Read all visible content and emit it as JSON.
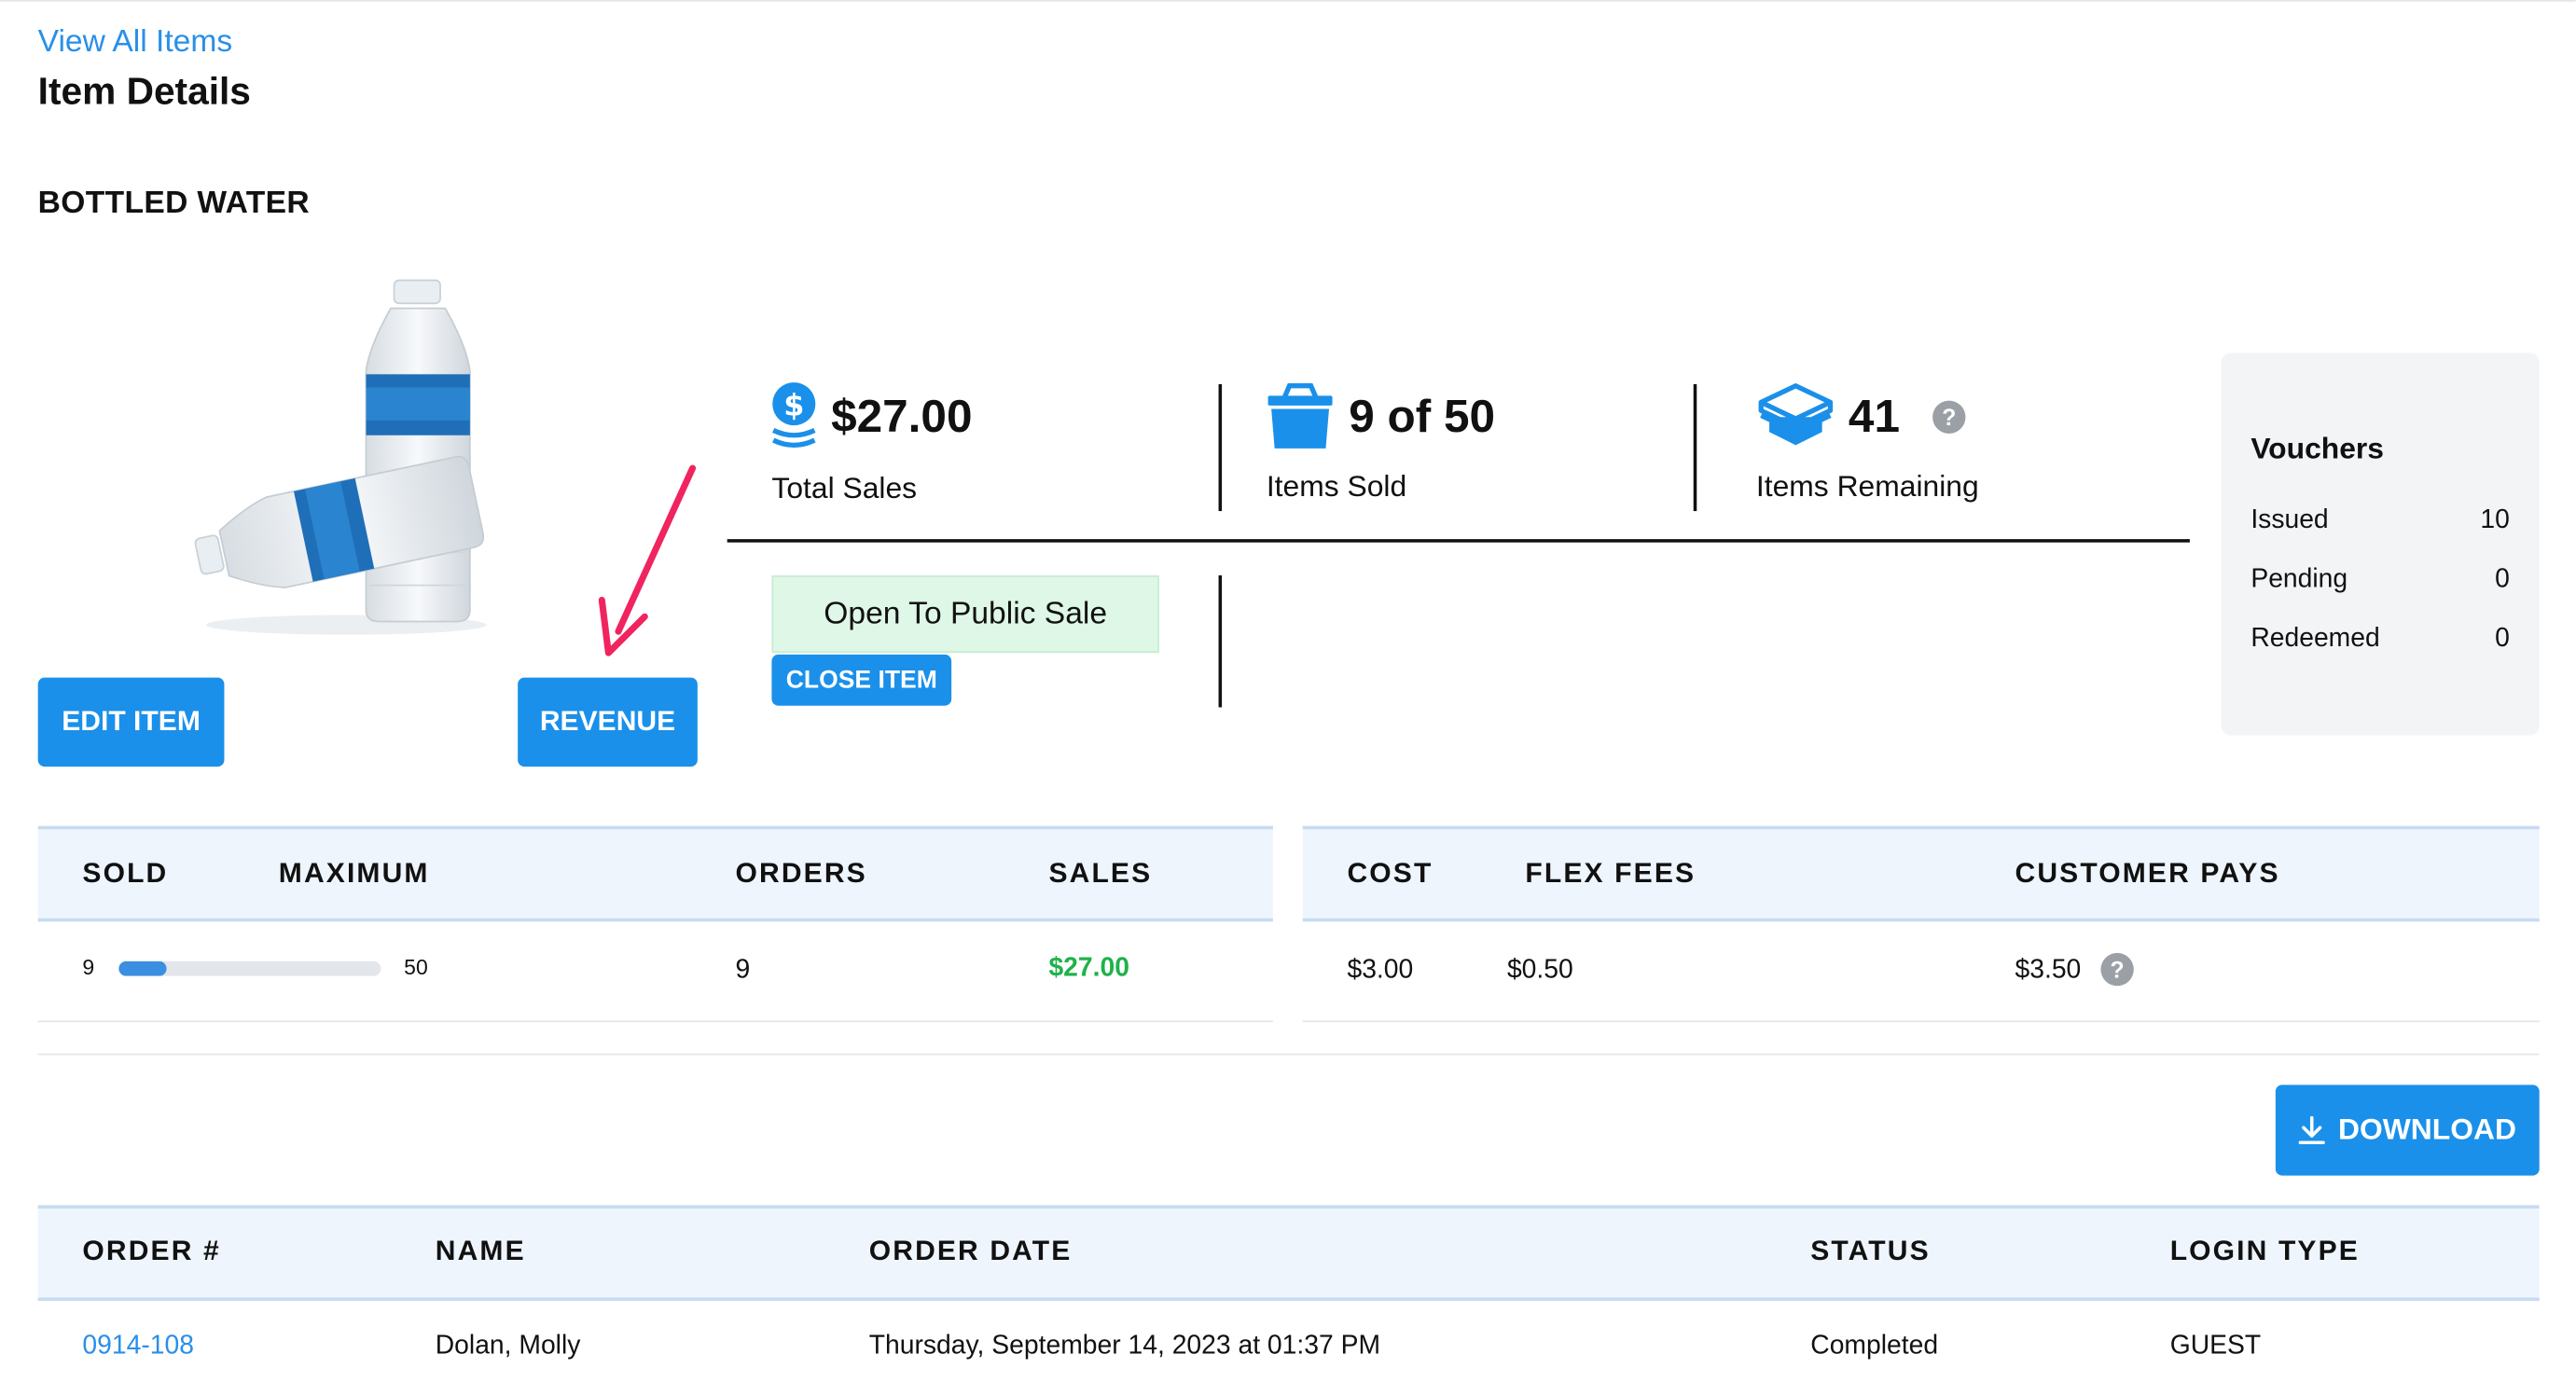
{
  "nav": {
    "view_all": "View All Items"
  },
  "page_title": "Item Details",
  "item": {
    "name": "BOTTLED WATER",
    "image_icon": "water-bottle-image"
  },
  "buttons": {
    "edit": "EDIT ITEM",
    "revenue": "REVENUE",
    "close_item": "CLOSE ITEM",
    "download": "DOWNLOAD"
  },
  "stats": {
    "total_sales": {
      "value": "$27.00",
      "label": "Total Sales",
      "icon": "coins-dollar-icon"
    },
    "items_sold": {
      "value": "9 of 50",
      "label": "Items Sold",
      "icon": "basket-icon"
    },
    "items_remaining": {
      "value": "41",
      "label": "Items Remaining",
      "icon": "open-box-icon"
    }
  },
  "sale_status": "Open To Public Sale",
  "vouchers": {
    "title": "Vouchers",
    "rows": [
      {
        "label": "Issued",
        "value": "10"
      },
      {
        "label": "Pending",
        "value": "0"
      },
      {
        "label": "Redeemed",
        "value": "0"
      }
    ]
  },
  "summary_left": {
    "headers": {
      "sold": "SOLD",
      "maximum": "MAXIMUM",
      "orders": "ORDERS",
      "sales": "SALES"
    },
    "row": {
      "sold": "9",
      "maximum": "50",
      "progress_fraction": 0.18,
      "orders": "9",
      "sales": "$27.00"
    }
  },
  "summary_right": {
    "headers": {
      "cost": "COST",
      "flex_fees": "FLEX FEES",
      "customer_pays": "CUSTOMER PAYS"
    },
    "row": {
      "cost": "$3.00",
      "flex_fees": "$0.50",
      "customer_pays": "$3.50"
    }
  },
  "orders_table": {
    "headers": {
      "order": "ORDER #",
      "name": "NAME",
      "date": "ORDER DATE",
      "status": "STATUS",
      "login": "LOGIN TYPE"
    },
    "rows": [
      {
        "order": "0914-108",
        "name": "Dolan, Molly",
        "date": "Thursday, September 14, 2023 at 01:37 PM",
        "status": "Completed",
        "login": "GUEST"
      }
    ]
  },
  "colors": {
    "accent": "#1a90ea",
    "link": "#2a8fe8",
    "sales_green": "#1fb24a",
    "annotation_arrow": "#f0245f"
  }
}
